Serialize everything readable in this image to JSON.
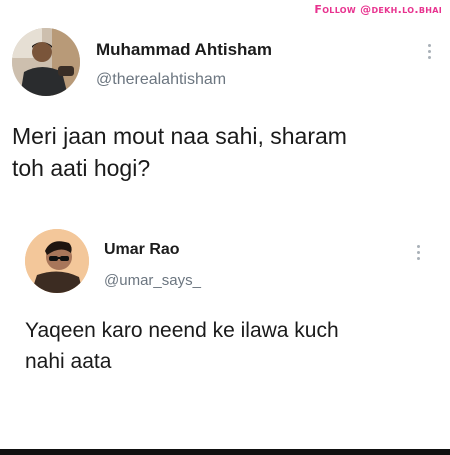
{
  "watermark": {
    "text": "Follow @dekh.lo.bhai",
    "color": "#e8338f"
  },
  "tweets": [
    {
      "author_name": "Muhammad Ahtisham",
      "handle": "@therealahtisham",
      "text_lines": [
        "Meri jaan mout naa sahi, sharam",
        "toh aati hogi?"
      ],
      "avatar_icon": "profile-photo",
      "menu_icon": "more-vertical-icon"
    },
    {
      "author_name": "Umar Rao",
      "handle": "@umar_says_",
      "text_lines": [
        "Yaqeen karo neend ke ilawa kuch",
        "nahi aata"
      ],
      "avatar_icon": "profile-photo",
      "menu_icon": "more-vertical-icon"
    }
  ],
  "colors": {
    "name": "#1c1c1c",
    "handle": "#6c7680",
    "text": "#1a1a1a",
    "background": "#ffffff"
  }
}
